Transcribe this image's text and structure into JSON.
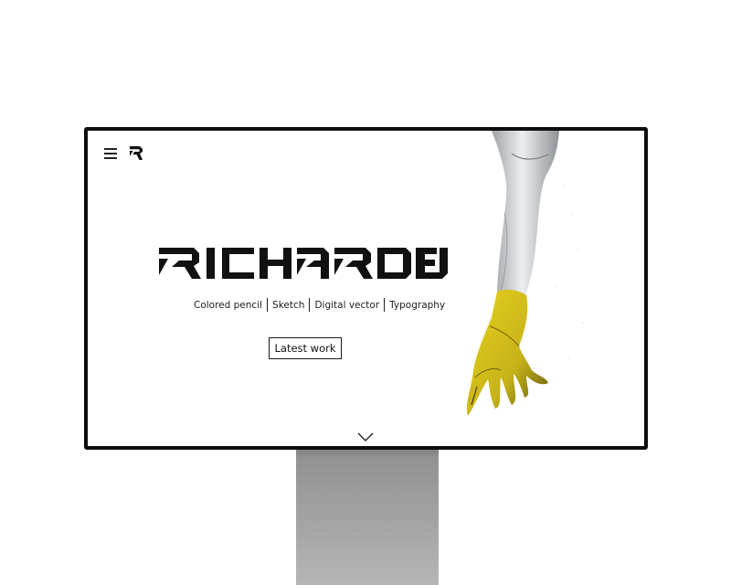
{
  "site": {
    "name": "RICHARD FU",
    "logo_letter": "R"
  },
  "nav": {
    "menu_icon": "hamburger-menu-icon",
    "logo_icon": "r-monogram-icon"
  },
  "hero": {
    "title": "RICHARD FU",
    "categories": [
      {
        "label": "Colored pencil"
      },
      {
        "label": "Sketch"
      },
      {
        "label": "Digital vector"
      },
      {
        "label": "Typography"
      }
    ],
    "cta_label": "Latest work",
    "scroll_icon": "chevron-down-icon",
    "artwork": "colored-pencil-arm-illustration"
  },
  "colors": {
    "ink": "#111111",
    "accent_gold": "#d9c31a",
    "bezel": "#0d0d0d",
    "stand": "#a0a0a0"
  }
}
